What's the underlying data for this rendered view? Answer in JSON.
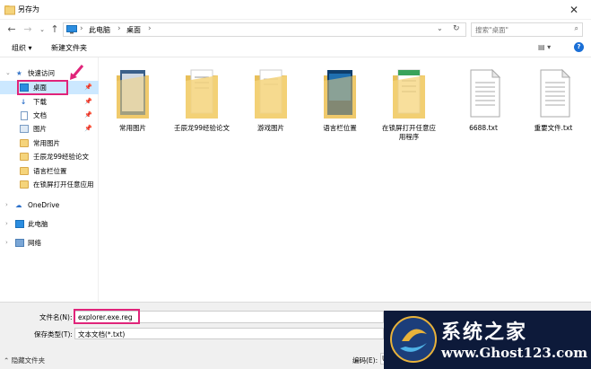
{
  "window": {
    "title": "另存为",
    "close_glyph": "✕"
  },
  "nav": {
    "back_icon": "arrow-left-icon",
    "forward_icon": "arrow-right-icon",
    "up_icon": "arrow-up-icon",
    "breadcrumbs": [
      "此电脑",
      "桌面"
    ],
    "refresh_glyph": "↻",
    "search_placeholder": "搜索\"桌面\""
  },
  "toolbar": {
    "organize_label": "组织 ▾",
    "new_folder_label": "新建文件夹",
    "view_glyph": "▤ ▾",
    "help_glyph": "?"
  },
  "sidebar": {
    "quick_access": "快速访问",
    "items": [
      {
        "label": "桌面",
        "pinned": true
      },
      {
        "label": "下载",
        "pinned": true
      },
      {
        "label": "文档",
        "pinned": true
      },
      {
        "label": "图片",
        "pinned": true
      },
      {
        "label": "常用图片",
        "pinned": false
      },
      {
        "label": "壬辰龙99经验论文",
        "pinned": false
      },
      {
        "label": "语言栏位置",
        "pinned": false
      },
      {
        "label": "在锁屏打开任意应用",
        "pinned": false
      }
    ],
    "onedrive": "OneDrive",
    "this_pc": "此电脑",
    "network": "网络"
  },
  "files": [
    {
      "label": "常用图片",
      "type": "folder"
    },
    {
      "label": "壬辰龙99经验论文",
      "type": "folder"
    },
    {
      "label": "游戏图片",
      "type": "folder"
    },
    {
      "label": "语言栏位置",
      "type": "folder"
    },
    {
      "label": "在锁屏打开任意应用程序",
      "type": "folder"
    },
    {
      "label": "6688.txt",
      "type": "txt"
    },
    {
      "label": "重要文件.txt",
      "type": "txt"
    }
  ],
  "bottom": {
    "filename_label": "文件名(N):",
    "filename_value": "explorer.exe.reg",
    "filetype_label": "保存类型(T):",
    "filetype_value": "文本文档(*.txt)",
    "hide_folders": "隐藏文件夹",
    "encoding_label": "编码(E):",
    "encoding_value": "U"
  },
  "watermark": {
    "cn": "系统之家",
    "url": "www.Ghost123.com"
  },
  "colors": {
    "highlight": "#e0247a",
    "selected_bg": "#cce8ff",
    "accent": "#0078d7"
  }
}
